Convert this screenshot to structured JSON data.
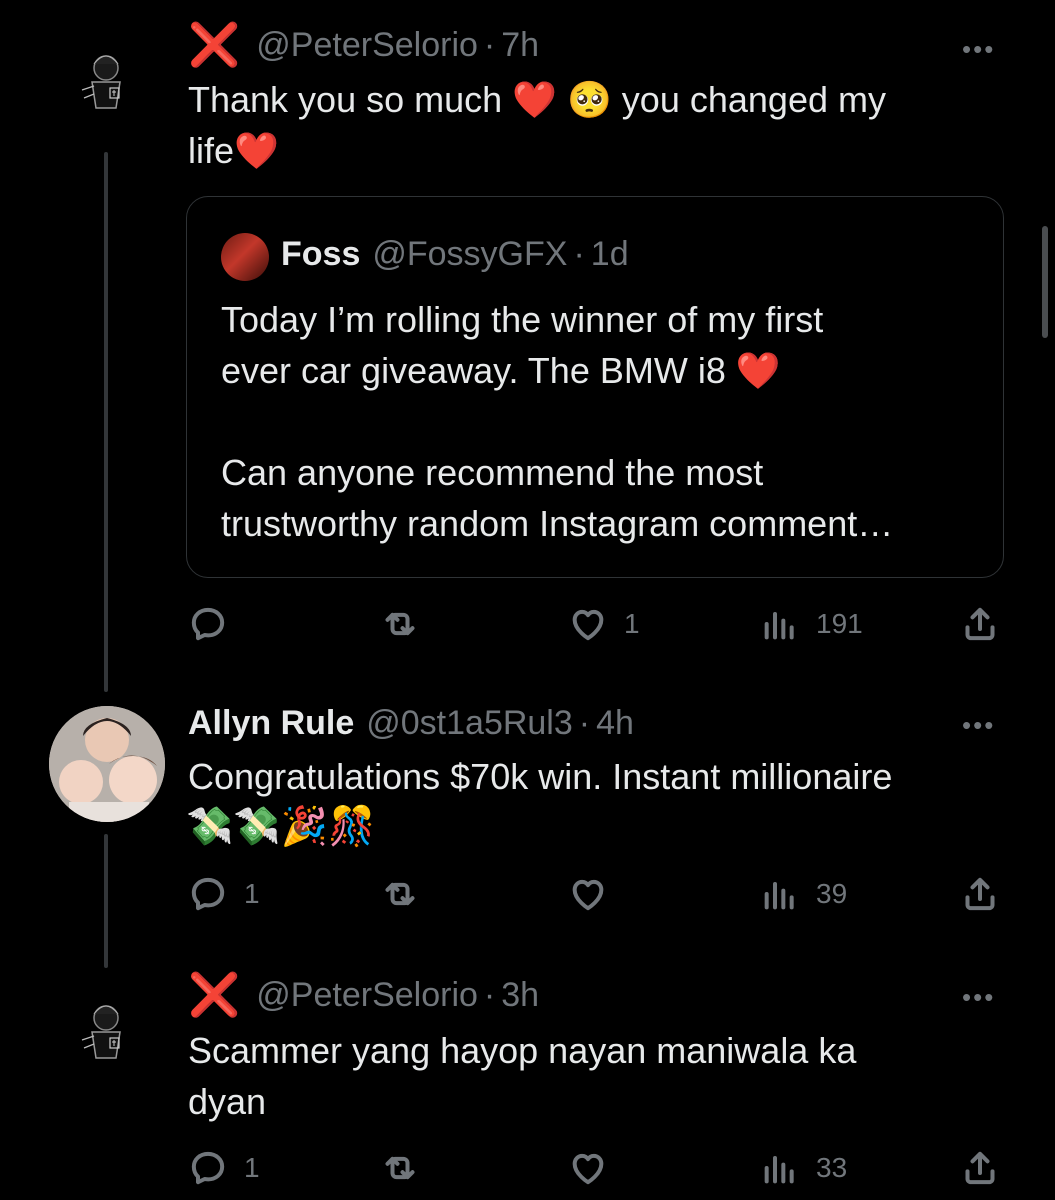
{
  "posts": [
    {
      "handle": "@PeterSelorio",
      "time": "7h",
      "text_line1": "Thank you so much ❤️ 🥺 you changed my",
      "text_line2": "life❤️",
      "quote": {
        "name": "Foss",
        "handle": "@FossyGFX",
        "time": "1d",
        "line1": "Today I’m rolling the winner of my first",
        "line2": "ever car giveaway. The BMW i8 ❤️",
        "line3": "Can anyone recommend the most",
        "line4": "trustworthy random Instagram comment…"
      },
      "actions": {
        "reply_count": "",
        "like_count": "1",
        "view_count": "191"
      }
    },
    {
      "name": "Allyn Rule",
      "handle": "@0st1a5Rul3",
      "time": "4h",
      "text_line1": "Congratulations $70k win. Instant millionaire",
      "text_line2": "💸💸🎉🎊",
      "actions": {
        "reply_count": "1",
        "like_count": "",
        "view_count": "39"
      }
    },
    {
      "handle": "@PeterSelorio",
      "time": "3h",
      "text_line1": "Scammer yang hayop nayan maniwala ka",
      "text_line2": "dyan",
      "actions": {
        "reply_count": "1",
        "like_count": "",
        "view_count": "33"
      }
    }
  ],
  "ui": {
    "x_mark": "❌",
    "dot": "·",
    "more": "•••"
  },
  "colors": {
    "background": "#000000",
    "text": "#e7e9ea",
    "muted": "#71767b",
    "x_red": "#f4212e",
    "border": "#2f3336"
  }
}
